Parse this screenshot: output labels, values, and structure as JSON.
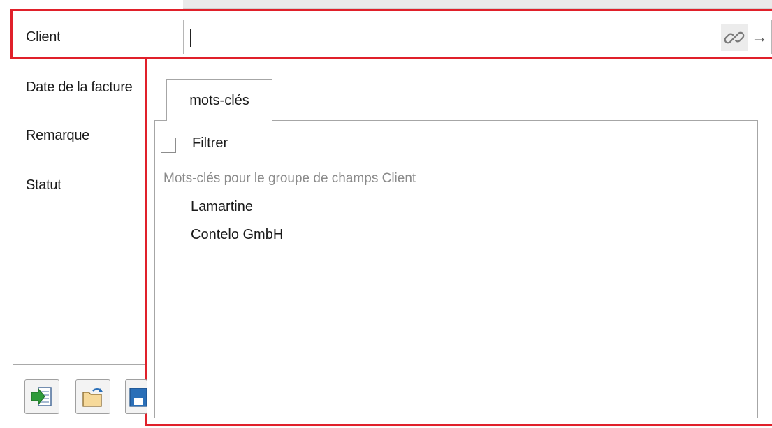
{
  "form": {
    "fields": [
      {
        "label": "Client"
      },
      {
        "label": "Date de la facture"
      },
      {
        "label": "Remarque"
      },
      {
        "label": "Statut"
      }
    ],
    "client_value": ""
  },
  "popup": {
    "tab_label": "mots-clés",
    "filter_label": "Filtrer",
    "filter_checked": false,
    "group_caption": "Mots-clés pour le groupe de champs Client",
    "keywords": [
      "Lamartine",
      "Contelo GmbH"
    ]
  },
  "icons": {
    "link": "link-icon",
    "arrow": "arrow-right-icon",
    "toolbar": [
      "import-green-arrow-icon",
      "open-folder-icon",
      "save-icon"
    ]
  },
  "colors": {
    "highlight": "#e0202a",
    "border": "#a6a6a6",
    "caption": "#8a8a8a"
  }
}
